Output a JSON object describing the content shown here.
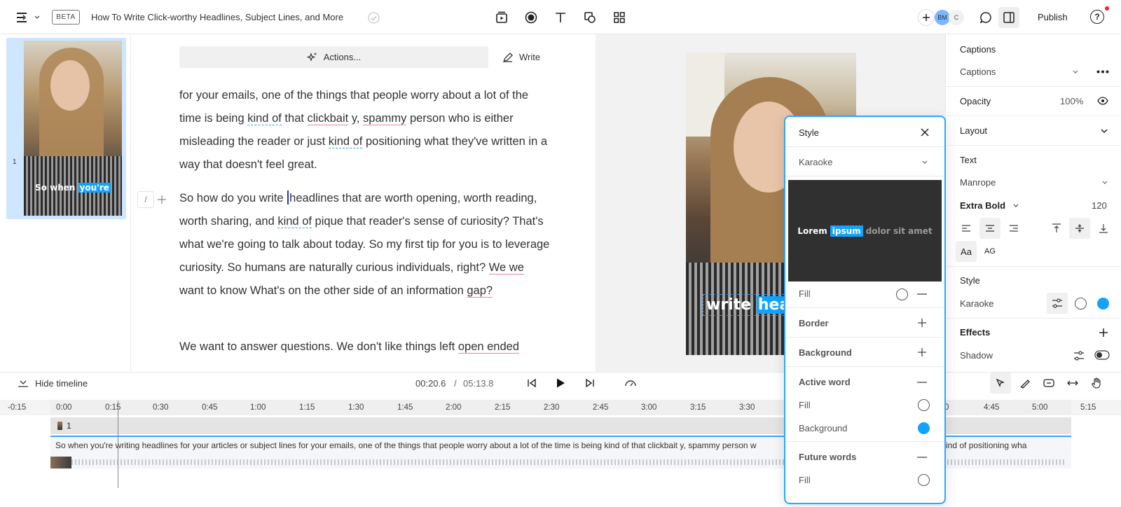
{
  "topbar": {
    "beta": "BETA",
    "doc_title": "How To Write Click-worthy Headlines, Subject Lines, and More",
    "avatars": [
      "BM",
      "C"
    ],
    "publish": "Publish",
    "help": "?"
  },
  "sidebar": {
    "scene_number": "1",
    "thumb_caption_plain": "So when",
    "thumb_caption_active": "you're"
  },
  "editor": {
    "actions_label": "Actions...",
    "write_label": "Write",
    "slash": "/",
    "para1": {
      "t1": "for your emails, one of the things that people worry about a lot of the time is being ",
      "u1": "kind of",
      "t2": " that ",
      "u2": "clickbait",
      "t3": " y, ",
      "u3": "spammy",
      "t4": " person who is either misleading the reader or just ",
      "u4": "kind of",
      "t5": " positioning what they've written in a way that doesn't feel great."
    },
    "para2": {
      "t1": "So how do you write ",
      "t2": "headlines that are worth opening, worth reading, worth sharing, and ",
      "u1": "kind of",
      "t3": " pique that reader's sense of curiosity? That's what we're going to talk about today. So my first tip for you is to leverage curiosity. So humans are naturally curious individuals, right? ",
      "u2": "We we",
      "t4": " want to know What's on the other side of an information ",
      "u3": "gap?"
    },
    "para3": {
      "t1": "We want to answer questions. We don't like things left ",
      "u1": "open ended"
    }
  },
  "canvas": {
    "caption_plain": "write",
    "caption_active": "hea"
  },
  "props": {
    "captions_title": "Captions",
    "captions_select": "Captions",
    "opacity_label": "Opacity",
    "opacity_value": "100%",
    "layout_label": "Layout",
    "text_label": "Text",
    "font": "Manrope",
    "weight": "Extra Bold",
    "size": "120",
    "case_aa": "Aa",
    "case_ag": "AG",
    "style_label": "Style",
    "style_value": "Karaoke",
    "effects_label": "Effects",
    "shadow_label": "Shadow",
    "active_color": "#12a3ff"
  },
  "style_panel": {
    "title": "Style",
    "preset": "Karaoke",
    "preview_word1": "Lorem",
    "preview_active": "ipsum",
    "preview_rest": "dolor sit amet",
    "fill": "Fill",
    "border": "Border",
    "background": "Background",
    "active_word": "Active word",
    "active_fill": "Fill",
    "active_background": "Background",
    "future_words": "Future words",
    "future_fill": "Fill"
  },
  "timeline": {
    "hide_label": "Hide timeline",
    "current_time": "00:20.6",
    "separator": "/",
    "total_time": "05:13.8",
    "ticks": [
      "-0:15",
      "0:00",
      "0:15",
      "0:30",
      "0:45",
      "1:00",
      "1:15",
      "1:30",
      "1:45",
      "2:00",
      "2:15",
      "2:30",
      "2:45",
      "3:00",
      "3:15",
      "3:30",
      "0",
      "4:45",
      "5:00",
      "5:15"
    ],
    "track_label": "1",
    "clip_text_left": "So when you're writing headlines for your articles or subject lines for your emails, one of the things that people worry about a lot of the time is being kind of that clickbait y, spammy person w",
    "clip_text_right": "ind of positioning wha"
  }
}
